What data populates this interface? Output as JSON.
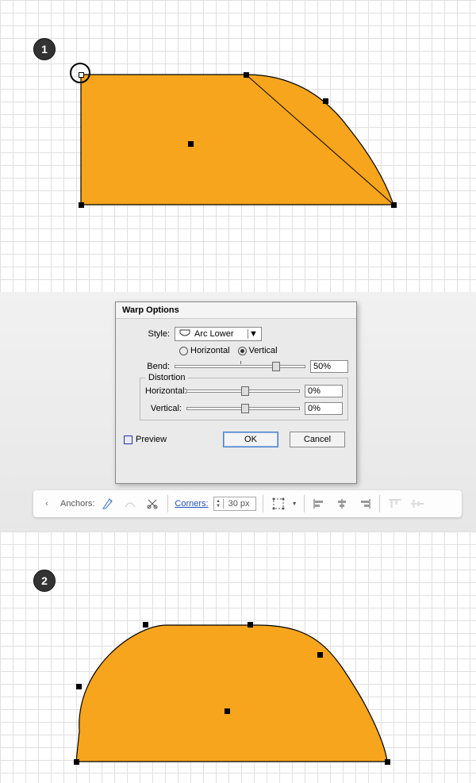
{
  "step1": {
    "label": "1"
  },
  "step2": {
    "label": "2"
  },
  "dialog": {
    "title": "Warp Options",
    "style_label": "Style:",
    "style_value": "Arc Lower",
    "orient_h": "Horizontal",
    "orient_v": "Vertical",
    "bend_label": "Bend:",
    "bend_value": "50%",
    "distortion_group": "Distortion",
    "dist_h_label": "Horizontal:",
    "dist_h_value": "0%",
    "dist_v_label": "Vertical:",
    "dist_v_value": "0%",
    "preview_label": "Preview",
    "ok": "OK",
    "cancel": "Cancel"
  },
  "toolbar": {
    "anchors_label": "Anchors:",
    "corners_label": "Corners:",
    "corners_value": "30 px"
  },
  "chart_data": {
    "type": "diagram",
    "note": "Tutorial figure showing Illustrator Warp Options applied to an orange shape; step 1 is the original shape with a highlighted top-left anchor, step 2 is the warped result (Arc Lower, Vertical, Bend 50%)."
  }
}
